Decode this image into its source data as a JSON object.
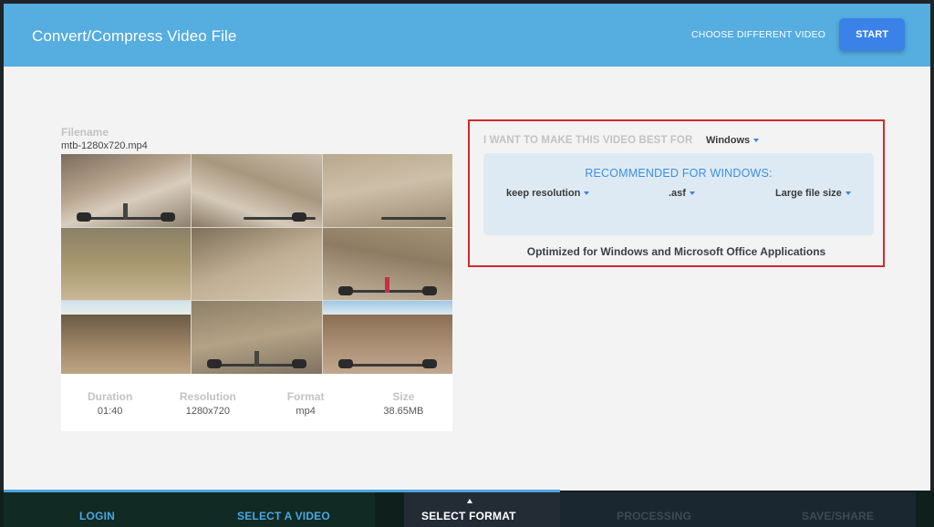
{
  "header": {
    "title": "Convert/Compress Video File",
    "choose_label": "CHOOSE DIFFERENT VIDEO",
    "start_label": "START"
  },
  "file": {
    "label": "Filename",
    "name": "mtb-1280x720.mp4"
  },
  "meta": [
    {
      "key": "Duration",
      "value": "01:40"
    },
    {
      "key": "Resolution",
      "value": "1280x720"
    },
    {
      "key": "Format",
      "value": "mp4"
    },
    {
      "key": "Size",
      "value": "38.65MB"
    }
  ],
  "panel": {
    "want_label": "I WANT TO MAKE THIS VIDEO BEST FOR",
    "target": "Windows",
    "recommended_title": "RECOMMENDED FOR WINDOWS:",
    "options": {
      "resolution": "keep resolution",
      "format": ".asf",
      "size": "Large file size"
    },
    "note": "Optimized for Windows and Microsoft Office Applications"
  },
  "steps": [
    {
      "label": "LOGIN",
      "color": "#4aa6e0"
    },
    {
      "label": "SELECT A VIDEO",
      "color": "#4aa6e0"
    },
    {
      "label": "SELECT FORMAT",
      "color": "#ffffff"
    },
    {
      "label": "PROCESSING",
      "color": "#3d4a55"
    },
    {
      "label": "SAVE/SHARE",
      "color": "#3d4a55"
    }
  ],
  "colors": {
    "header": "#55ade0",
    "accent": "#3b82e8",
    "highlight_border": "#d42a2a"
  }
}
